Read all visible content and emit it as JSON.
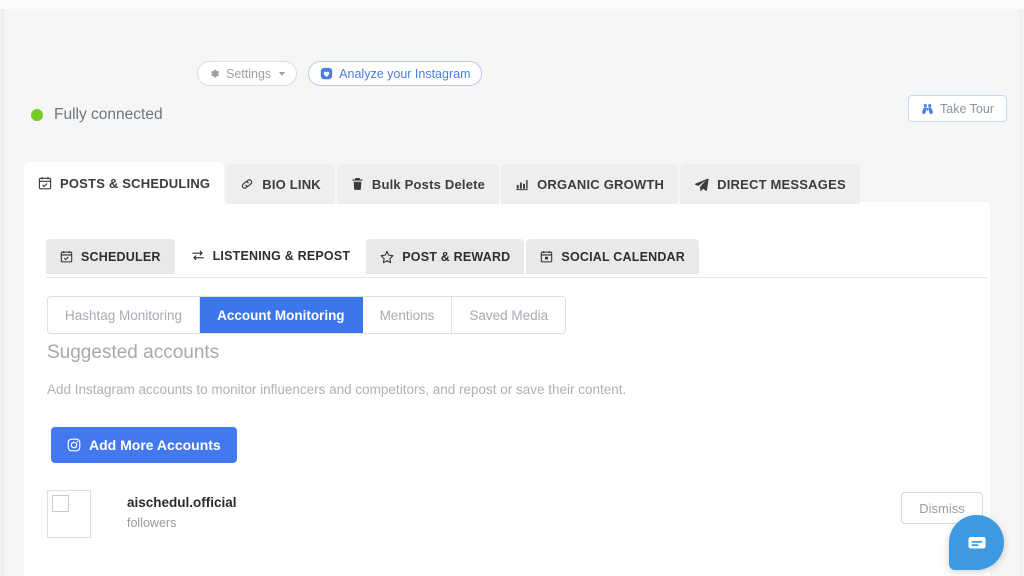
{
  "topbar": {
    "settings_label": "Settings",
    "settings_icon": "gear-icon",
    "analyze_label": "Analyze your Instagram",
    "analyze_icon": "instagram-heart-icon",
    "take_tour_label": "Take Tour",
    "take_tour_icon": "binoculars-icon"
  },
  "status": {
    "label": "Fully connected",
    "dot_color": "#74cc25"
  },
  "outer_tabs": [
    {
      "label": "POSTS & SCHEDULING",
      "icon": "calendar-check-icon",
      "active": true
    },
    {
      "label": "BIO LINK",
      "icon": "link-icon",
      "active": false
    },
    {
      "label": "Bulk Posts Delete",
      "icon": "trash-icon",
      "active": false
    },
    {
      "label": "ORGANIC GROWTH",
      "icon": "bar-chart-icon",
      "active": false
    },
    {
      "label": "DIRECT MESSAGES",
      "icon": "paper-plane-icon",
      "active": false
    }
  ],
  "inner_tabs": [
    {
      "label": "SCHEDULER",
      "icon": "calendar-check-icon",
      "active": false
    },
    {
      "label": "LISTENING & REPOST",
      "icon": "retweet-icon",
      "active": true
    },
    {
      "label": "POST & REWARD",
      "icon": "star-icon",
      "active": false
    },
    {
      "label": "SOCIAL CALENDAR",
      "icon": "calendar-alt-icon",
      "active": false
    }
  ],
  "segmented": [
    {
      "label": "Hashtag Monitoring",
      "active": false
    },
    {
      "label": "Account Monitoring",
      "active": true
    },
    {
      "label": "Mentions",
      "active": false
    },
    {
      "label": "Saved Media",
      "active": false
    }
  ],
  "content": {
    "section_title": "Suggested accounts",
    "section_desc": "Add Instagram accounts to monitor influencers and competitors, and repost or save their content.",
    "add_button_label": "Add More Accounts",
    "add_button_icon": "instagram-icon",
    "dismiss_label": "Dismiss"
  },
  "accounts": [
    {
      "username": "aischedul.official",
      "followers": "followers"
    }
  ],
  "chat": {
    "icon": "chat-bubble-icon"
  },
  "colors": {
    "accent_blue": "#3b76ed",
    "button_blue": "#4479ee",
    "link_blue": "#4a7fe0",
    "status_green": "#74cc25",
    "chat_blue": "#3d9ae0",
    "page_bg": "#f6f6f6",
    "card_bg": "#ffffff",
    "tab_inactive_bg": "#eeeeee"
  }
}
